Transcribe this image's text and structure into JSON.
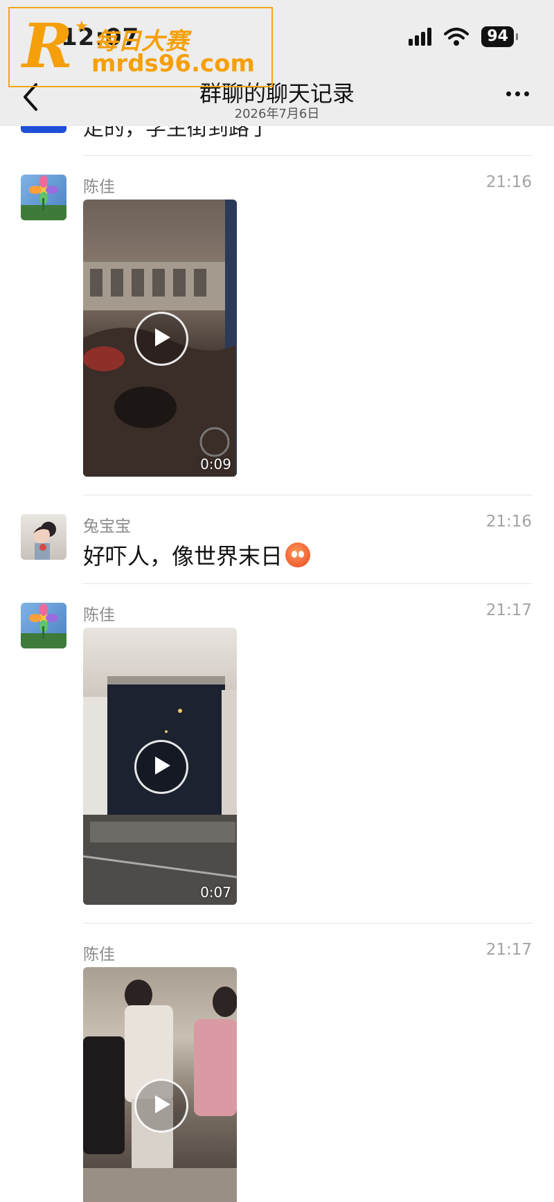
{
  "status": {
    "time": "12:07",
    "battery": "94"
  },
  "header": {
    "title": "群聊的聊天记录",
    "subtitle": "2026年7月6日"
  },
  "watermark": {
    "brand": "每日大赛",
    "url": "mrds96.com",
    "letter": "R"
  },
  "previous": {
    "text": "走的，学生街到路了"
  },
  "messages": [
    {
      "sender": "陈佳",
      "time": "21:16",
      "type": "video",
      "duration": "0:09"
    },
    {
      "sender": "兔宝宝",
      "time": "21:16",
      "type": "text",
      "text": "好吓人，像世界末日"
    },
    {
      "sender": "陈佳",
      "time": "21:17",
      "type": "video",
      "duration": "0:07"
    },
    {
      "sender": "陈佳",
      "time": "21:17",
      "type": "video"
    }
  ],
  "icons": [
    "back-arrow-icon",
    "more-icon",
    "play-icon",
    "signal-icon",
    "wifi-icon",
    "battery-icon",
    "emoji-sweat-icon"
  ]
}
